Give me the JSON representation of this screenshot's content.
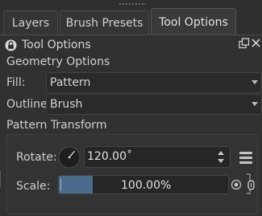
{
  "tabs": [
    {
      "label": "Layers"
    },
    {
      "label": "Brush Presets"
    },
    {
      "label": "Tool Options"
    }
  ],
  "panel": {
    "title": "Tool Options"
  },
  "geometry": {
    "section_label": "Geometry Options",
    "fill_label": "Fill:",
    "fill_value": "Pattern",
    "outline_label": "Outline:",
    "outline_value": "Brush"
  },
  "pattern_transform": {
    "section_label": "Pattern Transform",
    "rotate_label": "Rotate:",
    "rotate_value": "120.00˚",
    "scale_label": "Scale:",
    "scale_value": "100.00%",
    "scale_fill_fraction": 0.2
  },
  "colors": {
    "background": "#2f2f2f",
    "slider_fill": "#4a6a8c"
  }
}
